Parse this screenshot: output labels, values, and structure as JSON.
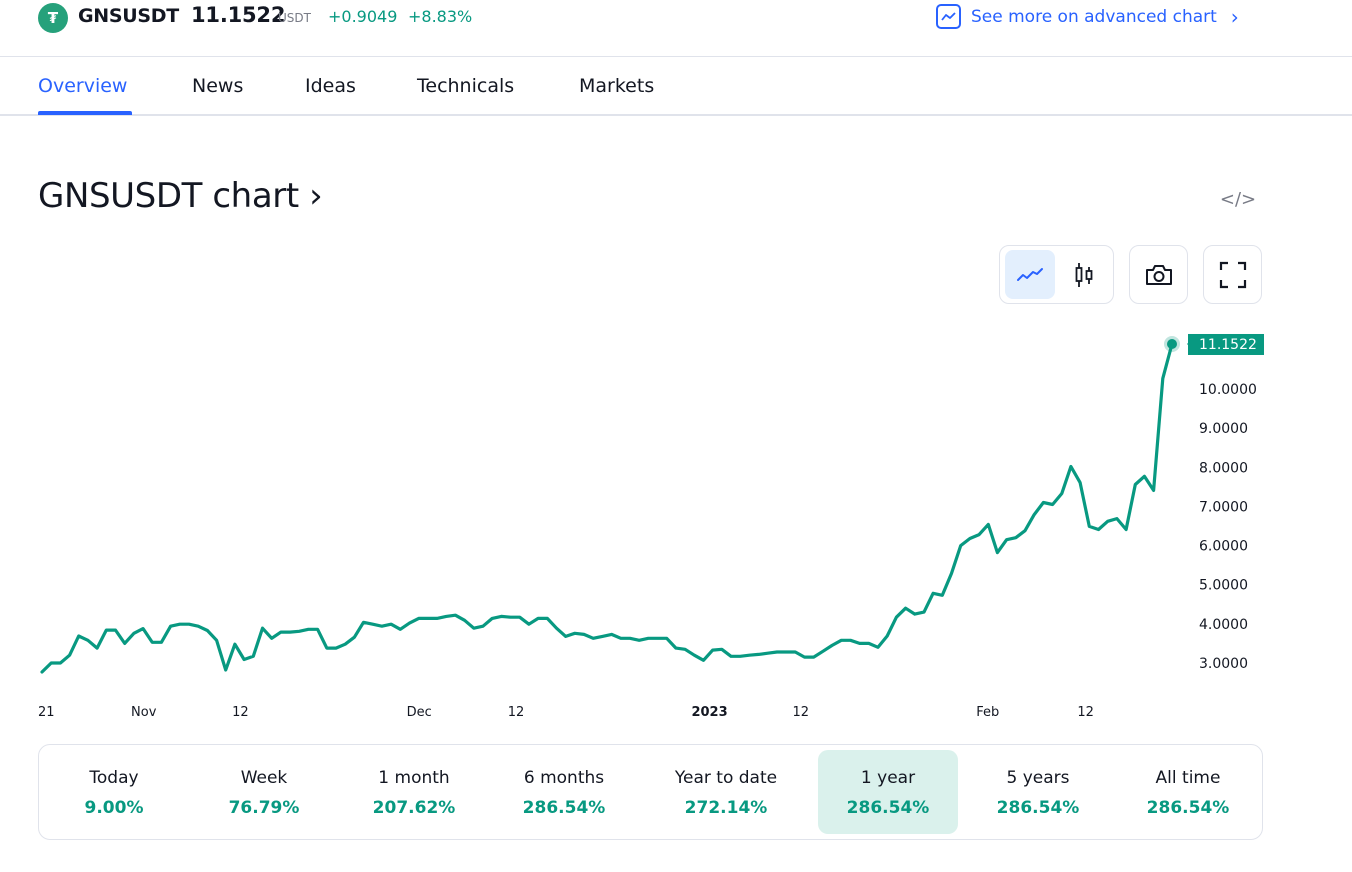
{
  "header": {
    "symbol": "GNSUSDT",
    "price": "11.1522",
    "currency": "USDT",
    "change": "+0.9049",
    "change_percent": "+8.83%",
    "logo_glyph": "₮",
    "advanced_chart_link": "See more on advanced chart",
    "advanced_chart_chevron": "›"
  },
  "tabs": [
    {
      "label": "Overview",
      "active": true
    },
    {
      "label": "News",
      "active": false
    },
    {
      "label": "Ideas",
      "active": false
    },
    {
      "label": "Technicals",
      "active": false
    },
    {
      "label": "Markets",
      "active": false
    }
  ],
  "chart_section": {
    "title": "GNSUSDT chart ›",
    "embed_icon": "</>",
    "toolbar": {
      "line_style_active": true,
      "icons": [
        "line-chart-icon",
        "candlestick-icon",
        "camera-icon",
        "fullscreen-icon"
      ]
    }
  },
  "colors": {
    "accent": "#2962ff",
    "positive": "#089981",
    "line": "#089981",
    "active_period_bg": "#daf1ec"
  },
  "chart_data": {
    "type": "line",
    "title": "GNSUSDT chart",
    "xlabel": "",
    "ylabel": "",
    "ylim": [
      2.8,
      11.6
    ],
    "grid": false,
    "y_ticks": [
      "3.0000",
      "4.0000",
      "5.0000",
      "6.0000",
      "7.0000",
      "8.0000",
      "9.0000",
      "10.0000"
    ],
    "y_tick_values": [
      3,
      4,
      5,
      6,
      7,
      8,
      9,
      10
    ],
    "x_ticks": [
      {
        "label": "21",
        "index": 0,
        "bold": false
      },
      {
        "label": "Nov",
        "index": 11,
        "bold": false
      },
      {
        "label": "12",
        "index": 22,
        "bold": false
      },
      {
        "label": "Dec",
        "index": 41,
        "bold": false
      },
      {
        "label": "12",
        "index": 52,
        "bold": false
      },
      {
        "label": "2023",
        "index": 72,
        "bold": true
      },
      {
        "label": "12",
        "index": 83,
        "bold": false
      },
      {
        "label": "Feb",
        "index": 103,
        "bold": false
      },
      {
        "label": "12",
        "index": 114,
        "bold": false
      }
    ],
    "last_value_label": "11.1522",
    "series": [
      {
        "name": "GNSUSDT",
        "values": [
          2.77,
          3.0,
          3.0,
          3.2,
          3.69,
          3.58,
          3.38,
          3.84,
          3.84,
          3.5,
          3.76,
          3.88,
          3.53,
          3.53,
          3.94,
          3.99,
          3.99,
          3.94,
          3.83,
          3.58,
          2.82,
          3.48,
          3.09,
          3.17,
          3.89,
          3.63,
          3.79,
          3.79,
          3.81,
          3.86,
          3.86,
          3.38,
          3.38,
          3.48,
          3.66,
          4.04,
          3.99,
          3.94,
          3.99,
          3.86,
          4.02,
          4.14,
          4.14,
          4.14,
          4.19,
          4.22,
          4.09,
          3.89,
          3.94,
          4.14,
          4.19,
          4.17,
          4.17,
          3.99,
          4.14,
          4.14,
          3.89,
          3.68,
          3.76,
          3.73,
          3.63,
          3.68,
          3.73,
          3.63,
          3.63,
          3.58,
          3.63,
          3.63,
          3.63,
          3.38,
          3.35,
          3.2,
          3.07,
          3.33,
          3.35,
          3.17,
          3.17,
          3.2,
          3.22,
          3.25,
          3.28,
          3.28,
          3.28,
          3.15,
          3.15,
          3.3,
          3.45,
          3.58,
          3.58,
          3.5,
          3.5,
          3.4,
          3.69,
          4.17,
          4.4,
          4.25,
          4.3,
          4.78,
          4.73,
          5.29,
          6.0,
          6.18,
          6.28,
          6.54,
          5.82,
          6.15,
          6.2,
          6.38,
          6.79,
          7.1,
          7.05,
          7.33,
          8.02,
          7.61,
          6.49,
          6.41,
          6.62,
          6.69,
          6.41,
          7.56,
          7.77,
          7.41,
          10.27,
          11.15
        ]
      }
    ]
  },
  "performance": [
    {
      "label": "Today",
      "value": "9.00%",
      "active": false
    },
    {
      "label": "Week",
      "value": "76.79%",
      "active": false
    },
    {
      "label": "1 month",
      "value": "207.62%",
      "active": false
    },
    {
      "label": "6 months",
      "value": "286.54%",
      "active": false
    },
    {
      "label": "Year to date",
      "value": "272.14%",
      "active": false
    },
    {
      "label": "1 year",
      "value": "286.54%",
      "active": true
    },
    {
      "label": "5 years",
      "value": "286.54%",
      "active": false
    },
    {
      "label": "All time",
      "value": "286.54%",
      "active": false
    }
  ]
}
